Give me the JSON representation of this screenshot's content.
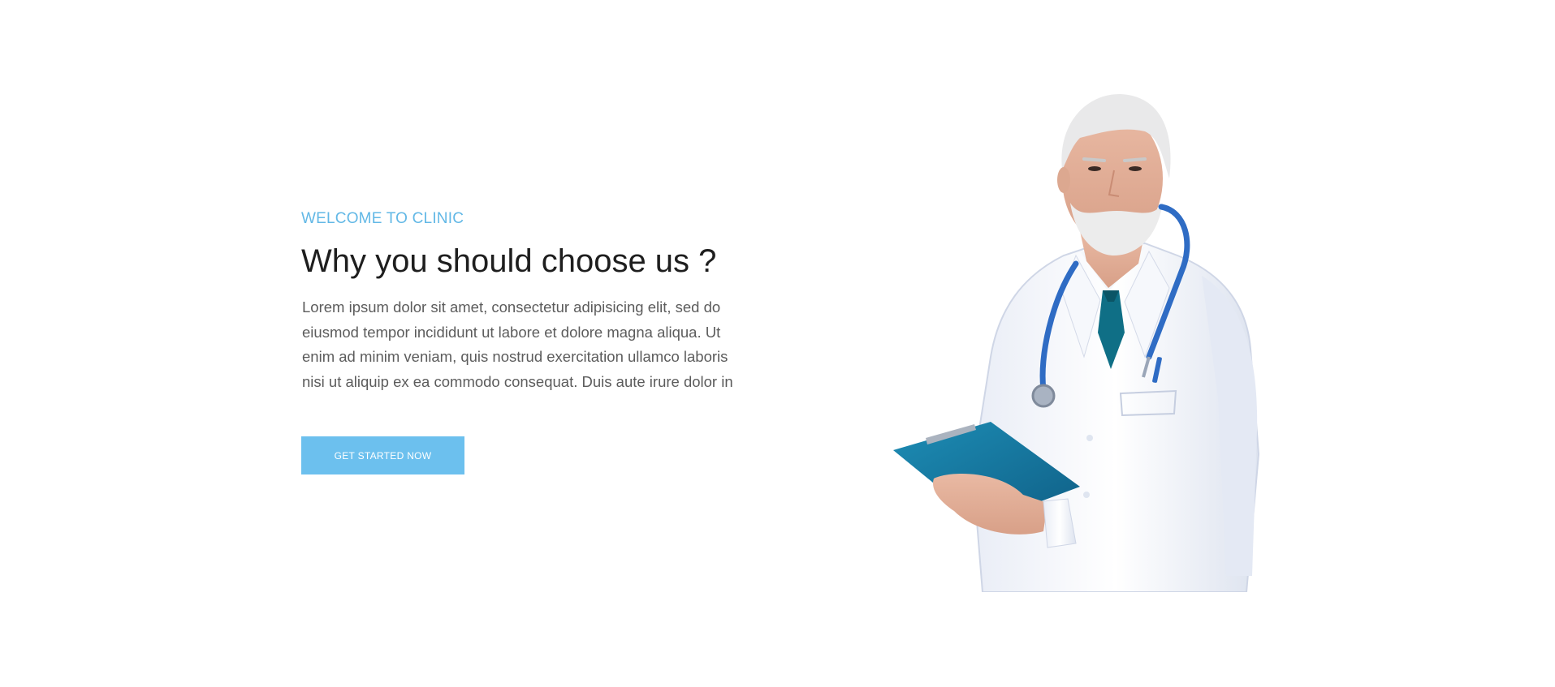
{
  "hero": {
    "kicker": "WELCOME TO CLINIC",
    "title": "Why you should choose us ?",
    "description": "Lorem ipsum dolor sit amet, consectetur adipisicing elit, sed do eiusmod tempor incididunt ut labore et dolore magna aliqua. Ut enim ad minim veniam, quis nostrud exercitation ullamco laboris nisi ut aliquip ex ea commodo consequat. Duis aute irure dolor in",
    "cta_label": "GET STARTED NOW"
  },
  "colors": {
    "accent": "#6cc0ee",
    "kicker": "#62b8e6",
    "title": "#1e1e1e",
    "body": "#5c5c5c",
    "clipboard": "#1a7fa3",
    "stethoscope": "#2f6cc4"
  }
}
